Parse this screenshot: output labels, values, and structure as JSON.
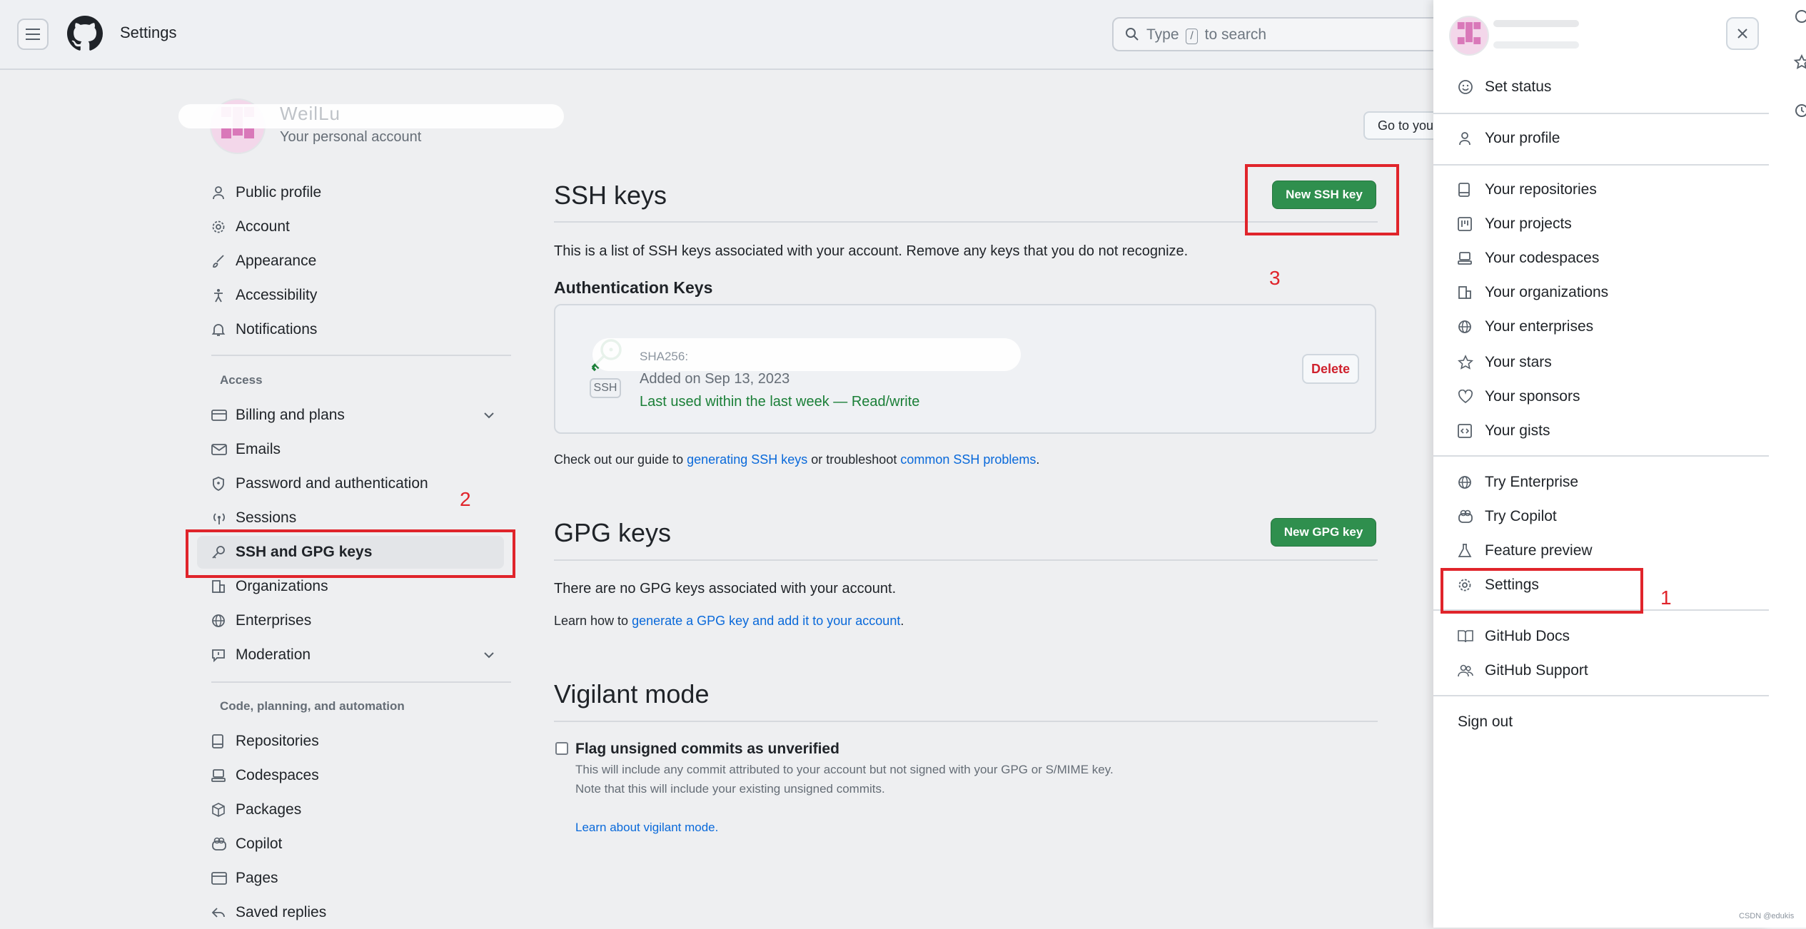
{
  "header": {
    "title": "Settings",
    "search_prefix": "Type",
    "search_key": "/",
    "search_suffix": "to search"
  },
  "profile": {
    "name": "WeilLu",
    "subtitle": "Your personal account",
    "goto_button": "Go to your personal profile"
  },
  "sidebar": {
    "items_top": [
      {
        "label": "Public profile",
        "icon": "person-icon"
      },
      {
        "label": "Account",
        "icon": "gear-icon"
      },
      {
        "label": "Appearance",
        "icon": "paintbrush-icon"
      },
      {
        "label": "Accessibility",
        "icon": "accessibility-icon"
      },
      {
        "label": "Notifications",
        "icon": "bell-icon"
      }
    ],
    "access_label": "Access",
    "items_access": [
      {
        "label": "Billing and plans",
        "icon": "credit-card-icon"
      },
      {
        "label": "Emails",
        "icon": "mail-icon"
      },
      {
        "label": "Password and authentication",
        "icon": "shield-lock-icon"
      },
      {
        "label": "Sessions",
        "icon": "broadcast-icon"
      },
      {
        "label": "SSH and GPG keys",
        "icon": "key-icon"
      },
      {
        "label": "Organizations",
        "icon": "organization-icon"
      },
      {
        "label": "Enterprises",
        "icon": "globe-icon"
      },
      {
        "label": "Moderation",
        "icon": "report-icon"
      }
    ],
    "code_label": "Code, planning, and automation",
    "items_code": [
      {
        "label": "Repositories",
        "icon": "repo-icon"
      },
      {
        "label": "Codespaces",
        "icon": "codespaces-icon"
      },
      {
        "label": "Packages",
        "icon": "package-icon"
      },
      {
        "label": "Copilot",
        "icon": "copilot-icon"
      },
      {
        "label": "Pages",
        "icon": "browser-icon"
      },
      {
        "label": "Saved replies",
        "icon": "reply-icon"
      }
    ]
  },
  "ssh": {
    "title": "SSH keys",
    "new_button": "New SSH key",
    "description": "This is a list of SSH keys associated with your account. Remove any keys that you do not recognize.",
    "auth_heading": "Authentication Keys",
    "key": {
      "title": "SHA256:",
      "added": "Added on Sep 13, 2023",
      "last_used": "Last used within the last week — Read/write",
      "badge": "SSH",
      "delete_label": "Delete"
    },
    "guide_prefix": "Check out our guide to",
    "guide_link1": "generating SSH keys",
    "guide_middle": "or troubleshoot",
    "guide_link2": "common SSH problems",
    "guide_end": "."
  },
  "gpg": {
    "title": "GPG keys",
    "new_button": "New GPG key",
    "empty_text": "There are no GPG keys associated with your account.",
    "learn_prefix": "Learn how to",
    "learn_link": "generate a GPG key and add it to your account",
    "learn_end": "."
  },
  "vigilant": {
    "title": "Vigilant mode",
    "checkbox_label": "Flag unsigned commits as unverified",
    "note1": "This will include any commit attributed to your account but not signed with your GPG or S/MIME key.",
    "note2": "Note that this will include your existing unsigned commits.",
    "learn_link": "Learn about vigilant mode."
  },
  "dropdown": {
    "set_status": "Set status",
    "group1": [
      {
        "label": "Your profile",
        "icon": "person-icon"
      }
    ],
    "group2": [
      {
        "label": "Your repositories",
        "icon": "repo-icon"
      },
      {
        "label": "Your projects",
        "icon": "project-icon"
      },
      {
        "label": "Your codespaces",
        "icon": "codespaces-icon"
      },
      {
        "label": "Your organizations",
        "icon": "organization-icon"
      },
      {
        "label": "Your enterprises",
        "icon": "globe-icon"
      },
      {
        "label": "Your stars",
        "icon": "star-icon"
      },
      {
        "label": "Your sponsors",
        "icon": "heart-icon"
      },
      {
        "label": "Your gists",
        "icon": "code-square-icon"
      }
    ],
    "group3": [
      {
        "label": "Try Enterprise",
        "icon": "globe-icon"
      },
      {
        "label": "Try Copilot",
        "icon": "copilot-icon"
      },
      {
        "label": "Feature preview",
        "icon": "beaker-icon"
      },
      {
        "label": "Settings",
        "icon": "gear-icon"
      }
    ],
    "group4": [
      {
        "label": "GitHub Docs",
        "icon": "book-icon"
      },
      {
        "label": "GitHub Support",
        "icon": "people-icon"
      }
    ],
    "sign_out": "Sign out"
  },
  "annotations": {
    "one": "1",
    "two": "2",
    "three": "3",
    "color": "#e0242b"
  },
  "watermark": "CSDN @edukis",
  "colors": {
    "accent": "#0969da",
    "green_button": "#2f8f4e",
    "danger": "#cf222e",
    "success_text": "#1a7f37"
  }
}
